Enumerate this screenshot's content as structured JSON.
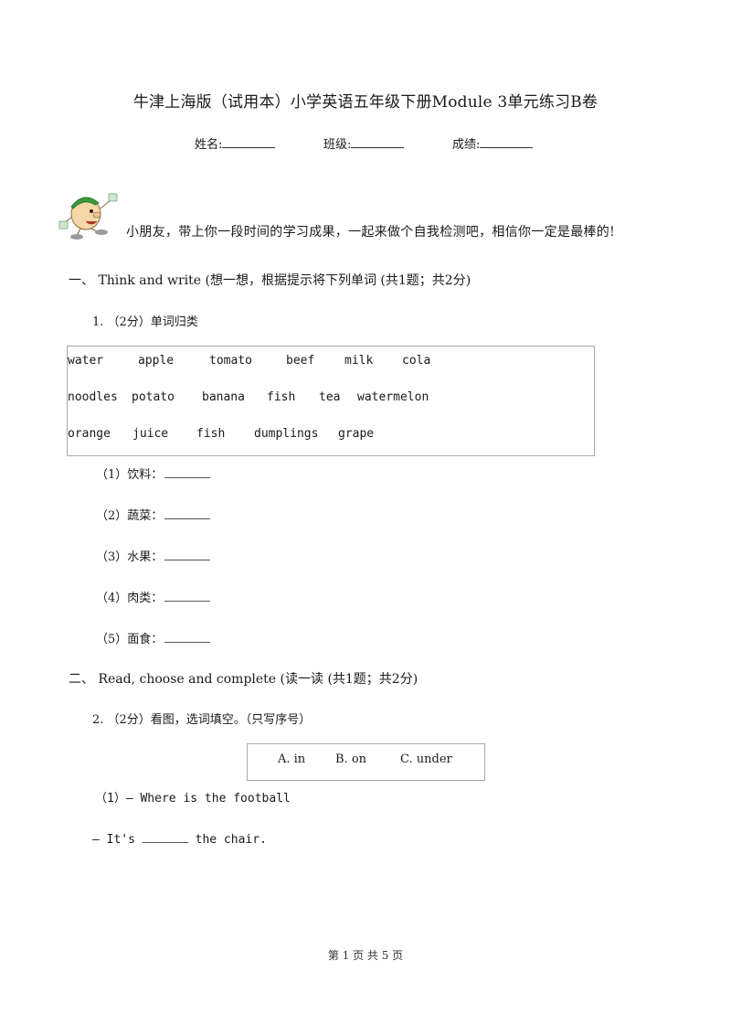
{
  "header": {
    "title": "牛津上海版（试用本）小学英语五年级下册Module 3单元练习B卷",
    "fields": [
      {
        "label": "姓名:",
        "value": ""
      },
      {
        "label": "班级:",
        "value": ""
      },
      {
        "label": "成绩:",
        "value": ""
      }
    ]
  },
  "intro": {
    "mascot_icon": "cartoon-boy-mascot",
    "text": "小朋友，带上你一段时间的学习成果，一起来做个自我检测吧，相信你一定是最棒的!"
  },
  "section1": {
    "heading": "一、 Think and write (想一想，根据提示将下列单词 (共1题；共2分)",
    "question": {
      "label": "1. （2分）单词归类",
      "word_rows": [
        [
          "water",
          "apple",
          "tomato",
          "beef",
          "milk",
          "cola"
        ],
        [
          "noodles",
          "potato",
          "banana",
          "fish",
          "tea",
          "watermelon"
        ],
        [
          "orange",
          "juice",
          "fish",
          "dumplings",
          "grape"
        ]
      ],
      "items": [
        {
          "label": "（1）饮料：",
          "answer": ""
        },
        {
          "label": "（2）蔬菜：",
          "answer": ""
        },
        {
          "label": "（3）水果：",
          "answer": ""
        },
        {
          "label": "（4）肉类：",
          "answer": ""
        },
        {
          "label": "（5）面食：",
          "answer": ""
        }
      ]
    }
  },
  "section2": {
    "heading": "二、 Read, choose and complete (读一读 (共1题；共2分)",
    "question": {
      "label": "2. （2分）看图，选词填空。（只写序号）",
      "options": [
        "A. in",
        "B. on",
        "C. under"
      ],
      "line1": "（1）— Where is the football",
      "line2_prefix": "— It's",
      "line2_suffix": "the chair."
    }
  },
  "footer": {
    "page_text": "第 1 页 共 5 页"
  }
}
